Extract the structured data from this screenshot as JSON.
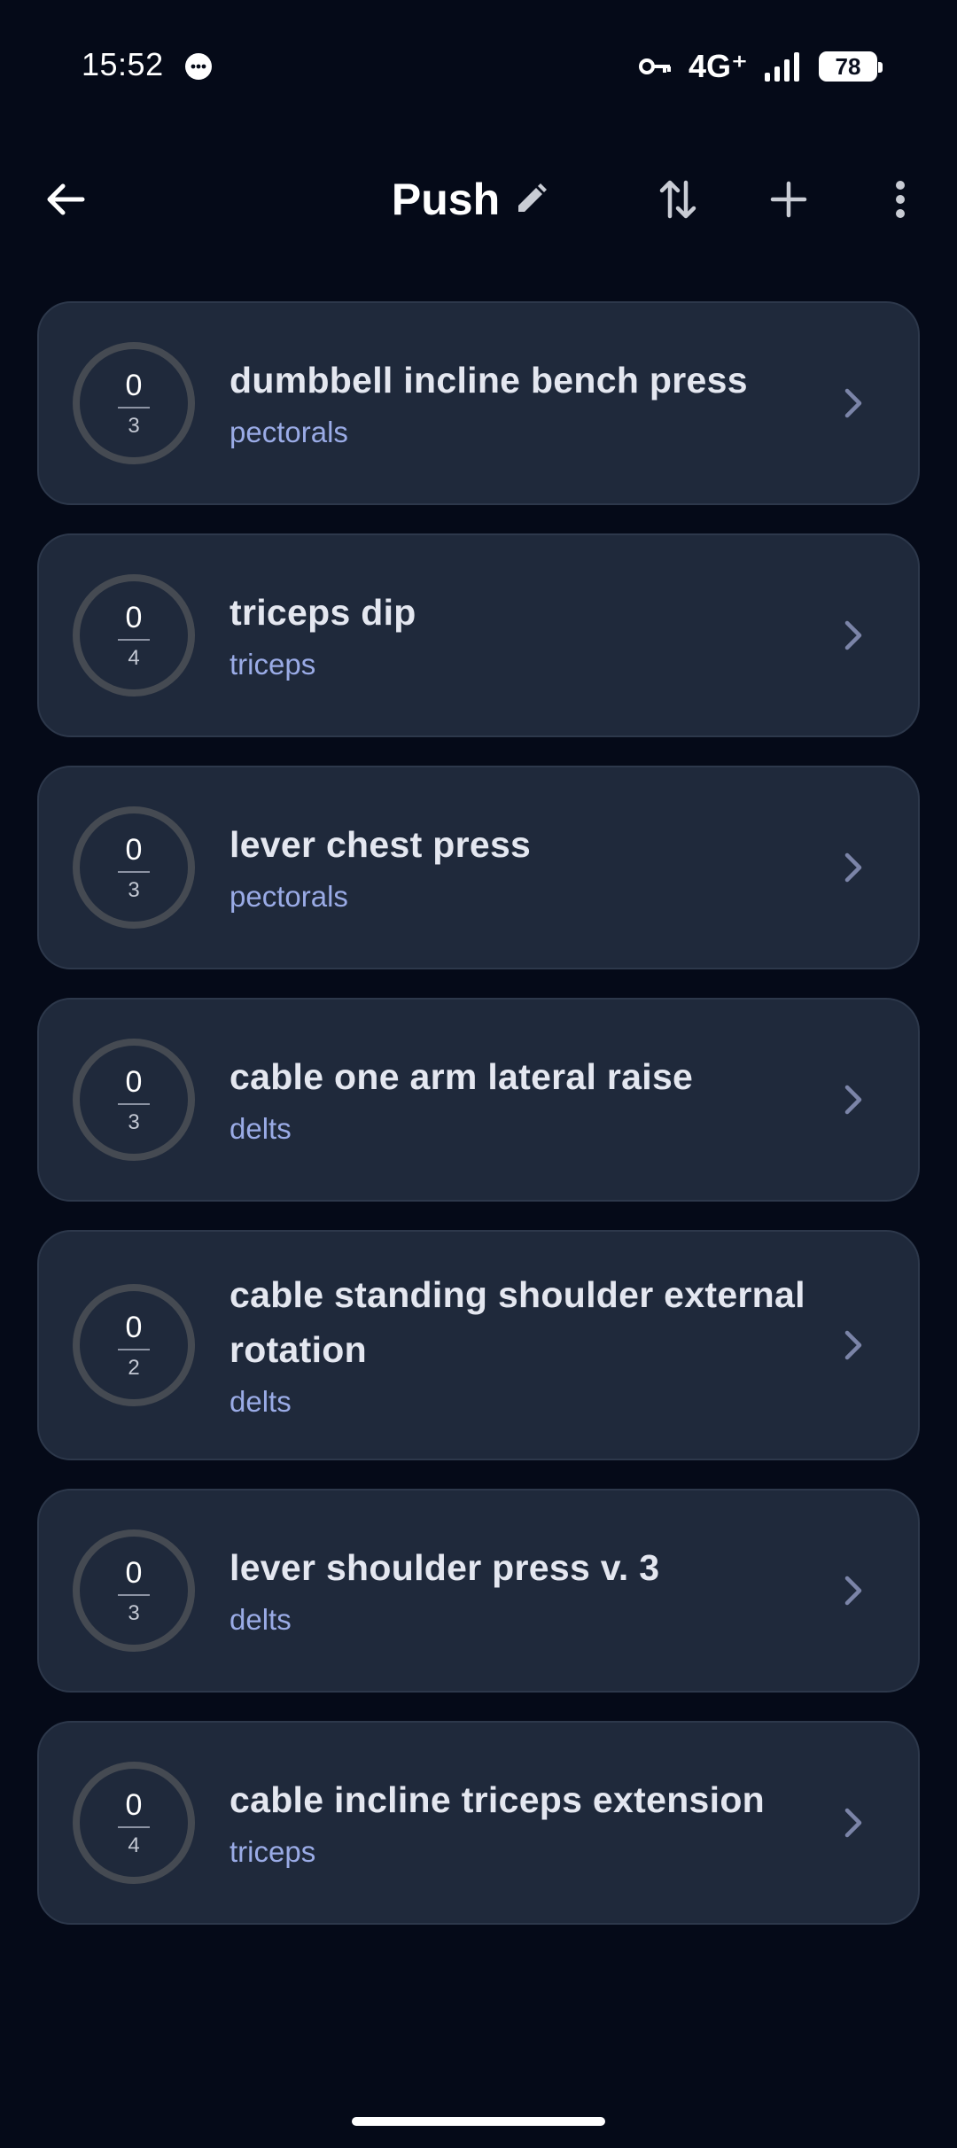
{
  "status_bar": {
    "time": "15:52",
    "network": "4G⁺",
    "battery": "78"
  },
  "app_bar": {
    "title": "Push"
  },
  "exercises": [
    {
      "name": "dumbbell incline bench press",
      "muscle": "pectorals",
      "done": "0",
      "total": "3"
    },
    {
      "name": "triceps dip",
      "muscle": "triceps",
      "done": "0",
      "total": "4"
    },
    {
      "name": "lever chest press",
      "muscle": "pectorals",
      "done": "0",
      "total": "3"
    },
    {
      "name": "cable one arm lateral raise",
      "muscle": "delts",
      "done": "0",
      "total": "3"
    },
    {
      "name": "cable standing shoulder external rotation",
      "muscle": "delts",
      "done": "0",
      "total": "2"
    },
    {
      "name": "lever shoulder press v. 3",
      "muscle": "delts",
      "done": "0",
      "total": "3"
    },
    {
      "name": "cable incline triceps extension",
      "muscle": "triceps",
      "done": "0",
      "total": "4"
    }
  ],
  "icons": {
    "back": "arrow-left-icon",
    "edit": "pencil-icon",
    "sort": "swap-vertical-icon",
    "add": "plus-icon",
    "more": "more-vertical-icon",
    "chevron": "chevron-right-icon"
  },
  "colors": {
    "background": "#050a18",
    "card": "#1f293b",
    "muscle_text": "#9aabe6",
    "ring": "#454a52"
  }
}
